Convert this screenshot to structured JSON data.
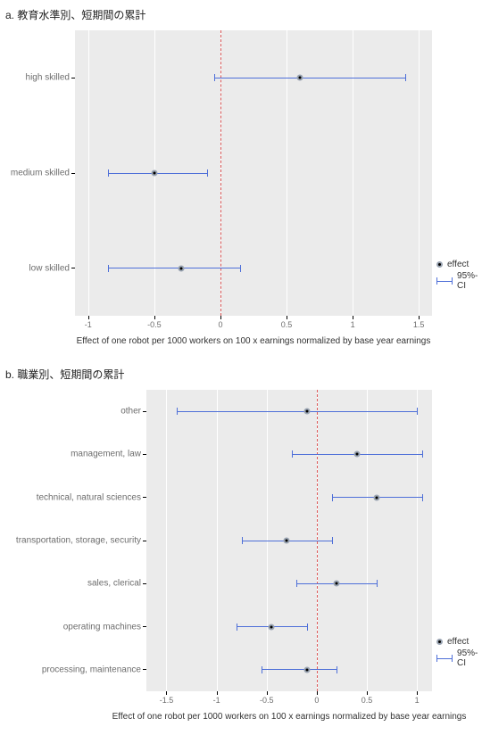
{
  "panel_a": {
    "title": "a. 教育水準別、短期間の累計",
    "xlabel": "Effect of one robot per 1000 workers on 100 x earnings normalized by base year earnings",
    "legend": {
      "effect": "effect",
      "ci": "95%-CI"
    }
  },
  "panel_b": {
    "title": "b. 職業別、短期間の累計",
    "xlabel": "Effect of one robot per 1000 workers on 100 x earnings normalized by base year earnings",
    "legend": {
      "effect": "effect",
      "ci": "95%-CI"
    }
  },
  "chart_data": [
    {
      "id": "a",
      "type": "scatter",
      "title": "教育水準別、短期間の累計",
      "xlabel": "Effect of one robot per 1000 workers on 100 x earnings normalized by base year earnings",
      "ylabel": "",
      "x_ticks": [
        -1,
        -0.5,
        0,
        0.5,
        1,
        1.5
      ],
      "xlim": [
        -1.1,
        1.6
      ],
      "reference_line": 0,
      "series": [
        {
          "name": "effect",
          "role": "point",
          "color": "#000000"
        },
        {
          "name": "95%-CI",
          "role": "errorbar",
          "color": "#4e6fd8"
        }
      ],
      "categories": [
        "high skilled",
        "medium skilled",
        "low skilled"
      ],
      "points": [
        {
          "category": "high skilled",
          "effect": 0.6,
          "ci_low": -0.05,
          "ci_high": 1.4
        },
        {
          "category": "medium skilled",
          "effect": -0.5,
          "ci_low": -0.85,
          "ci_high": -0.1
        },
        {
          "category": "low skilled",
          "effect": -0.3,
          "ci_low": -0.85,
          "ci_high": 0.15
        }
      ]
    },
    {
      "id": "b",
      "type": "scatter",
      "title": "職業別、短期間の累計",
      "xlabel": "Effect of one robot per 1000 workers on 100 x earnings normalized by base year earnings",
      "ylabel": "",
      "x_ticks": [
        -1.5,
        -1,
        -0.5,
        0,
        0.5,
        1
      ],
      "xlim": [
        -1.7,
        1.15
      ],
      "reference_line": 0,
      "series": [
        {
          "name": "effect",
          "role": "point",
          "color": "#000000"
        },
        {
          "name": "95%-CI",
          "role": "errorbar",
          "color": "#4e6fd8"
        }
      ],
      "categories": [
        "other",
        "management, law",
        "technical, natural sciences",
        "transportation, storage, security",
        "sales, clerical",
        "operating machines",
        "processing, maintenance"
      ],
      "points": [
        {
          "category": "other",
          "effect": -0.1,
          "ci_low": -1.4,
          "ci_high": 1.0
        },
        {
          "category": "management, law",
          "effect": 0.4,
          "ci_low": -0.25,
          "ci_high": 1.05
        },
        {
          "category": "technical, natural sciences",
          "effect": 0.6,
          "ci_low": 0.15,
          "ci_high": 1.05
        },
        {
          "category": "transportation, storage, security",
          "effect": -0.3,
          "ci_low": -0.75,
          "ci_high": 0.15
        },
        {
          "category": "sales, clerical",
          "effect": 0.2,
          "ci_low": -0.2,
          "ci_high": 0.6
        },
        {
          "category": "operating machines",
          "effect": -0.45,
          "ci_low": -0.8,
          "ci_high": -0.1
        },
        {
          "category": "processing, maintenance",
          "effect": -0.1,
          "ci_low": -0.55,
          "ci_high": 0.2
        }
      ]
    }
  ]
}
